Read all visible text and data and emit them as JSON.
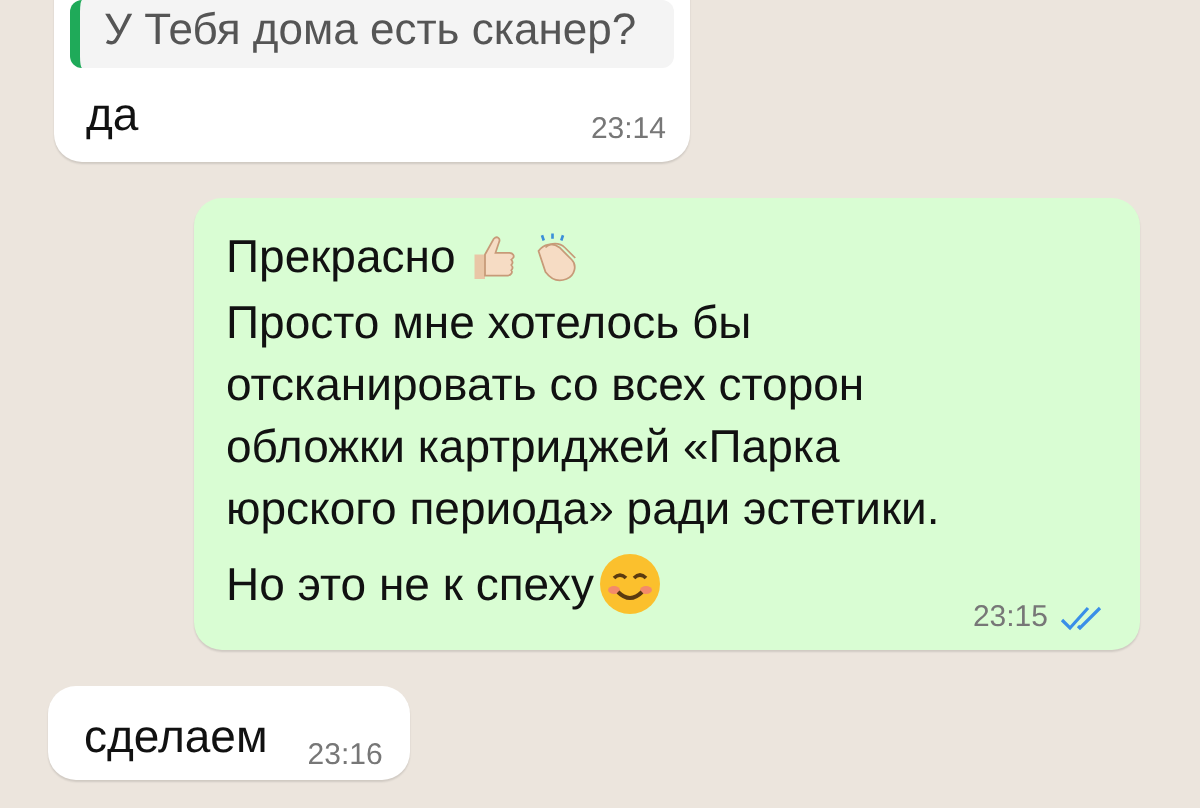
{
  "messages": [
    {
      "kind": "incoming",
      "quote": "У Тебя дома есть сканер?",
      "text": "да",
      "time": "23:14"
    },
    {
      "kind": "outgoing",
      "paragraphs": [
        {
          "kind": "reactions",
          "text": "Прекрасно"
        },
        {
          "kind": "plain",
          "text": "Просто мне хотелось бы\nотсканировать со всех сторон\nобложки картриджей «Парка\nюрского периода» ради эстетики."
        },
        {
          "kind": "smile",
          "text": "Но это не к спеху"
        }
      ],
      "time": "23:15",
      "read": true
    },
    {
      "kind": "incoming",
      "text": "сделаем",
      "time": "23:16"
    }
  ]
}
